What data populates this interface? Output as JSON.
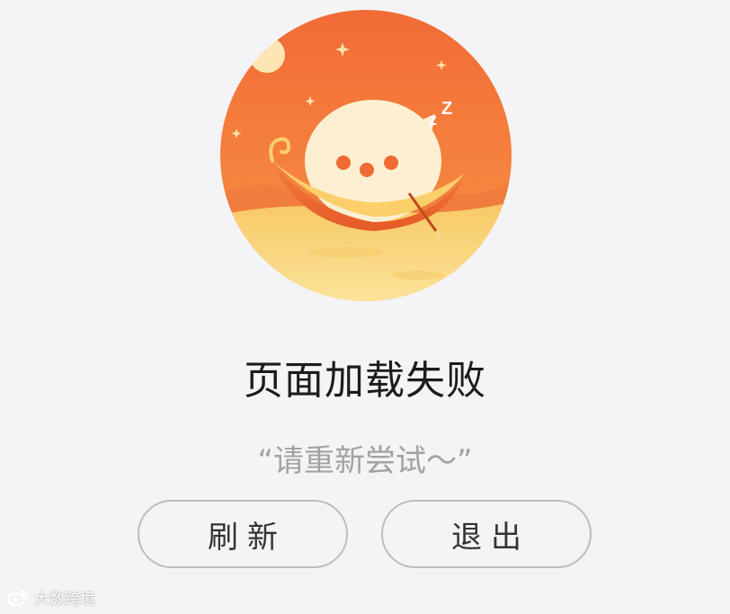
{
  "error": {
    "title": "页面加载失败",
    "subtitle": "“请重新尝试～”"
  },
  "buttons": {
    "refresh_label": "刷新",
    "exit_label": "退出"
  },
  "illustration": {
    "icon": "sleeping-chat-bubble-boat-icon",
    "sleep_text": "zZ"
  },
  "watermark": {
    "icon": "weibo-icon",
    "text": "大数跨境"
  },
  "colors": {
    "background": "#f4f4f6",
    "sky_top": "#f26b36",
    "sky_bottom": "#f8a04c",
    "sand": "#f8d978",
    "bubble": "#fdf0d2",
    "dots": "#f06a33",
    "title_text": "#1c1c1c",
    "subtitle_text": "#a2a2a2",
    "button_border": "#bdbdbd"
  }
}
